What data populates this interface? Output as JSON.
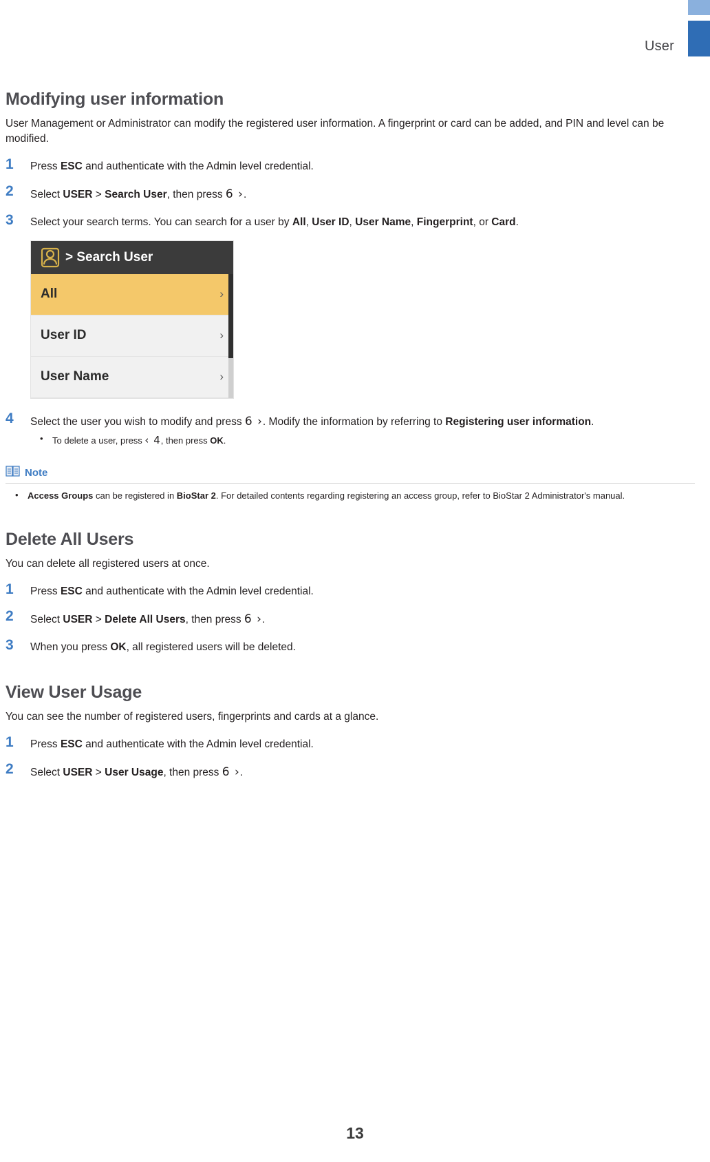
{
  "header": {
    "title": "User"
  },
  "sections": [
    {
      "title": "Modifying user information",
      "intro": "User Management or Administrator can modify the registered user information. A fingerprint or card can be added, and PIN and level can be modified."
    },
    {
      "title": "Delete All Users",
      "intro": "You can delete all registered users at once."
    },
    {
      "title": "View User Usage",
      "intro": "You can see the number of registered users, fingerprints and cards at a glance."
    }
  ],
  "steps_modify": [
    {
      "num": "1",
      "text_parts": [
        "Press ",
        "ESC",
        " and authenticate with the Admin level credential."
      ]
    },
    {
      "num": "2",
      "text_parts": [
        "Select ",
        "USER",
        " > ",
        "Search User",
        ", then press ",
        "6 ›",
        "."
      ]
    },
    {
      "num": "3",
      "text_parts": [
        "Select your search terms. You can search for a user by ",
        "All",
        ", ",
        "User ID",
        ", ",
        "User Name",
        ", ",
        "Fingerprint",
        ", or ",
        "Card",
        "."
      ]
    },
    {
      "num": "4",
      "text_parts": [
        "Select the user you wish to modify and press ",
        "6 ›",
        ". Modify the information by referring to ",
        "Registering user information",
        "."
      ]
    }
  ],
  "step4_bullet": {
    "pre": "To delete a user, press ",
    "key": "‹ 4",
    "mid": ", then press ",
    "bold": "OK",
    "post": "."
  },
  "screenshot": {
    "title": "> Search User",
    "icon": "user-icon",
    "rows": [
      {
        "label": "All",
        "selected": true,
        "chevron": "›"
      },
      {
        "label": "User ID",
        "selected": false,
        "chevron": "›"
      },
      {
        "label": "User Name",
        "selected": false,
        "chevron": "›"
      }
    ]
  },
  "note": {
    "icon": "note-book-icon",
    "label": "Note",
    "items": [
      {
        "b1": "Access Groups",
        "t1": " can be registered in ",
        "b2": "BioStar 2",
        "t2": ". For detailed contents regarding registering an access group, refer to BioStar 2 Administrator's manual."
      }
    ]
  },
  "steps_delete_all": [
    {
      "num": "1",
      "text_parts": [
        "Press ",
        "ESC",
        " and authenticate with the Admin level credential."
      ]
    },
    {
      "num": "2",
      "text_parts": [
        "Select ",
        "USER",
        " > ",
        "Delete All Users",
        ", then press ",
        "6 ›",
        "."
      ]
    },
    {
      "num": "3",
      "text_parts": [
        "When you press ",
        "OK",
        ", all registered users will be deleted."
      ]
    }
  ],
  "steps_usage": [
    {
      "num": "1",
      "text_parts": [
        "Press ",
        "ESC",
        " and authenticate with the Admin level credential."
      ]
    },
    {
      "num": "2",
      "text_parts": [
        "Select ",
        "USER",
        " > ",
        "User Usage",
        ", then press ",
        "6 ›",
        "."
      ]
    }
  ],
  "page_number": "13",
  "colors": {
    "accent_blue": "#3e7cc3",
    "header_blue_dark": "#2f6db5",
    "header_blue_light": "#8ab0dd",
    "selected_row": "#f4c86a",
    "shot_header": "#3b3b3b"
  }
}
